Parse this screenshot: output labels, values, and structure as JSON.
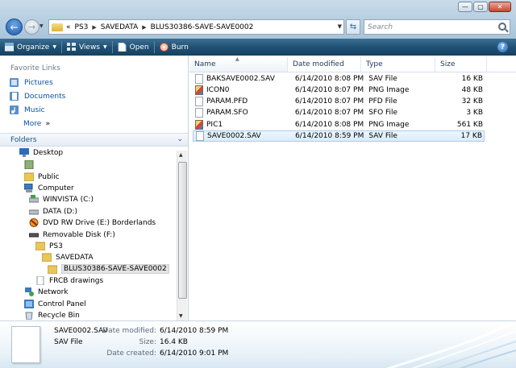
{
  "address": {
    "overflow": "«",
    "segments": [
      "PS3",
      "SAVEDATA",
      "BLUS30386-SAVE-SAVE0002"
    ]
  },
  "search": {
    "placeholder": "Search"
  },
  "toolbar": {
    "organize": "Organize",
    "views": "Views",
    "open": "Open",
    "burn": "Burn",
    "help": "?"
  },
  "favorites": {
    "heading": "Favorite Links",
    "items": [
      "Pictures",
      "Documents",
      "Music"
    ],
    "more": "More"
  },
  "folders": {
    "heading": "Folders",
    "tree": [
      {
        "label": "Desktop",
        "icon": "desktop-icon"
      },
      {
        "label": "",
        "icon": "user-folder-icon"
      },
      {
        "label": "Public",
        "icon": "folder-icon"
      },
      {
        "label": "Computer",
        "icon": "computer-icon"
      },
      {
        "label": "WINVISTA (C:)",
        "icon": "hard-drive-icon"
      },
      {
        "label": "DATA (D:)",
        "icon": "hard-drive-icon"
      },
      {
        "label": "DVD RW Drive (E:) Borderlands",
        "icon": "dvd-icon"
      },
      {
        "label": "Removable Disk (F:)",
        "icon": "removable-disk-icon"
      },
      {
        "label": "PS3",
        "icon": "folder-icon"
      },
      {
        "label": "SAVEDATA",
        "icon": "folder-icon"
      },
      {
        "label": "BLUS30386-SAVE-SAVE0002",
        "icon": "folder-icon"
      },
      {
        "label": "FRCB drawings",
        "icon": "document-icon"
      },
      {
        "label": "Network",
        "icon": "network-icon"
      },
      {
        "label": "Control Panel",
        "icon": "control-panel-icon"
      },
      {
        "label": "Recycle Bin",
        "icon": "recycle-bin-icon"
      }
    ]
  },
  "filelist": {
    "columns": [
      "Name",
      "Date modified",
      "Type",
      "Size"
    ],
    "rows": [
      {
        "name": "BAKSAVE0002.SAV",
        "date": "6/14/2010 8:08 PM",
        "type": "SAV File",
        "size": "16 KB",
        "icon": "file-icon"
      },
      {
        "name": "ICON0",
        "date": "6/14/2010 8:07 PM",
        "type": "PNG Image",
        "size": "48 KB",
        "icon": "png-image-icon"
      },
      {
        "name": "PARAM.PFD",
        "date": "6/14/2010 8:07 PM",
        "type": "PFD File",
        "size": "32 KB",
        "icon": "file-icon"
      },
      {
        "name": "PARAM.SFO",
        "date": "6/14/2010 8:07 PM",
        "type": "SFO File",
        "size": "3 KB",
        "icon": "file-icon"
      },
      {
        "name": "PIC1",
        "date": "6/14/2010 8:08 PM",
        "type": "PNG Image",
        "size": "561 KB",
        "icon": "png-image-icon"
      },
      {
        "name": "SAVE0002.SAV",
        "date": "6/14/2010 8:59 PM",
        "type": "SAV File",
        "size": "17 KB",
        "icon": "file-icon"
      }
    ]
  },
  "details": {
    "name": "SAVE0002.SAV",
    "type": "SAV File",
    "date_modified_label": "Date modified:",
    "date_modified": "6/14/2010 8:59 PM",
    "size_label": "Size:",
    "size": "16.4 KB",
    "date_created_label": "Date created:",
    "date_created": "6/14/2010 9:01 PM"
  },
  "colors": {
    "cmdbar": "#1e4f73",
    "link": "#0b51a3",
    "selection": "#dcebf9"
  }
}
